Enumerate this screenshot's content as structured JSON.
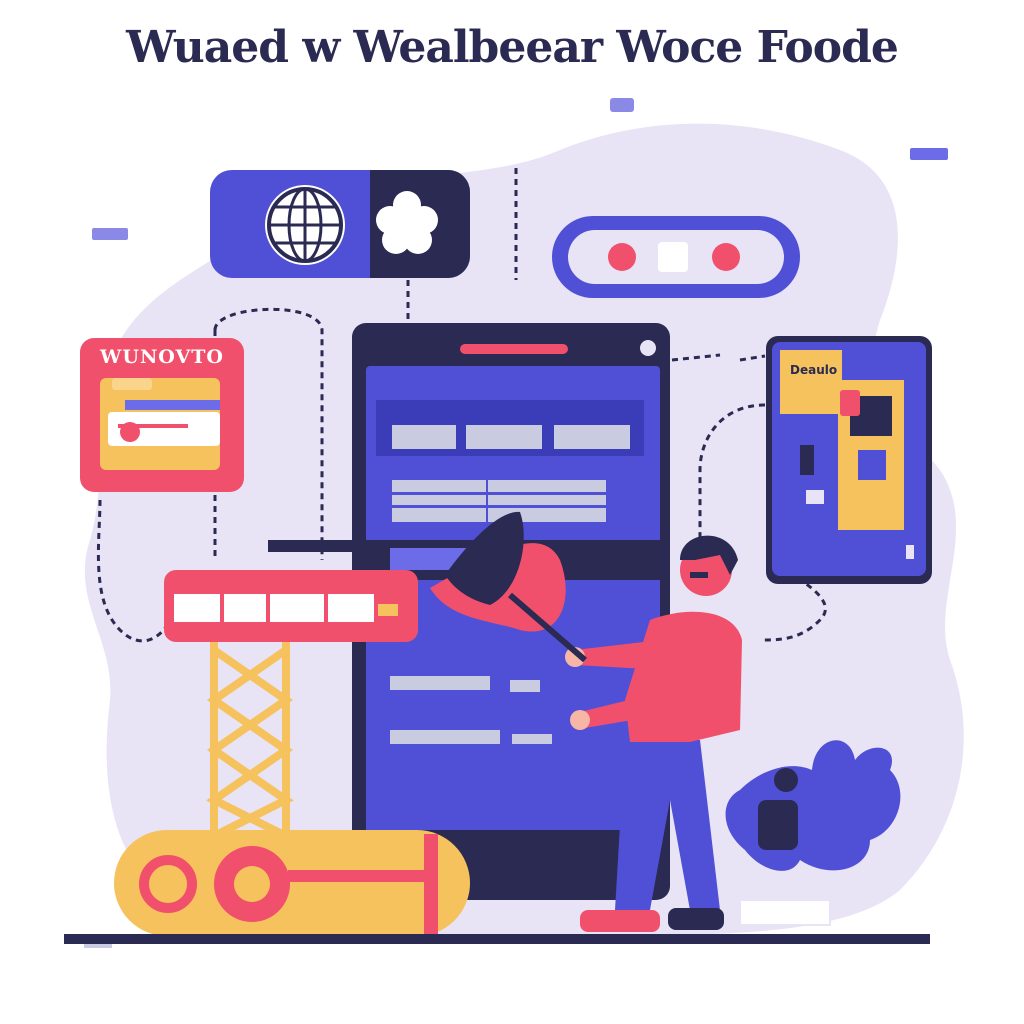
{
  "title": "Wuaed w Wealbeear Woce Foode",
  "folder_badge": {
    "label": "WUNOVTO"
  },
  "small_card": {
    "label": "Deaulo"
  },
  "colors": {
    "navy": "#2b2a52",
    "indigo": "#4f50d6",
    "indigo_light": "#6c6ce8",
    "coral": "#f0506b",
    "yellow": "#f6c25e",
    "lavender": "#e8e3f5",
    "grey": "#c9cbe0"
  },
  "icons": [
    "globe-icon",
    "flower-icon",
    "gamepad-icon",
    "folder-icon",
    "plant-icon",
    "crane-icon",
    "phone-icon"
  ]
}
